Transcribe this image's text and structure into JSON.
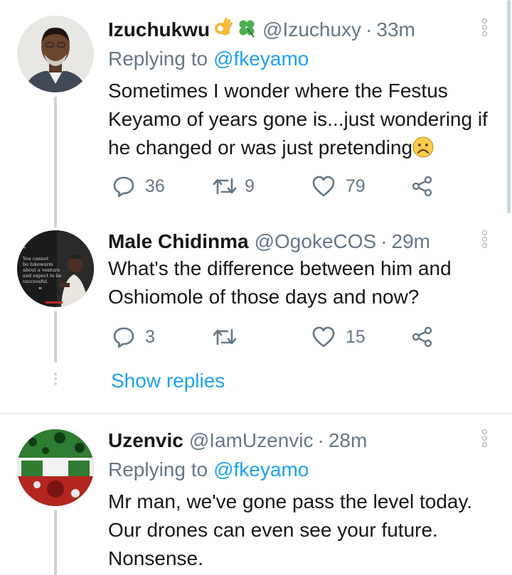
{
  "tweets": [
    {
      "name": "Izuchukwu",
      "emojis": [
        "ok-hand",
        "four-leaf-clover"
      ],
      "handle": "@Izuchuxy",
      "time": "33m",
      "replying_label": "Replying to",
      "replying_to": "@fkeyamo",
      "text": "Sometimes I wonder where the Festus Keyamo of years gone is...just wondering if he changed or was just pretending",
      "text_emoji": "frowning-face",
      "replies": "36",
      "retweets": "9",
      "likes": "79"
    },
    {
      "name": "Male Chidinma",
      "handle": "@OgokeCOS",
      "time": "29m",
      "text": "What's the difference between him and Oshiomole of those days and now?",
      "replies": "3",
      "retweets": "",
      "likes": "15",
      "show_replies": "Show replies"
    },
    {
      "name": "Uzenvic",
      "handle": "@IamUzenvic",
      "time": "28m",
      "replying_label": "Replying to",
      "replying_to": "@fkeyamo",
      "text": "Mr man, we've gone pass the level today. Our drones can even see your future. Nonsense."
    }
  ],
  "separator": "·",
  "avatar2_quote": "You cannot be lukewarm about a venture and expect to be successful.",
  "colors": {
    "link": "#1da1f2",
    "secondary": "#657786",
    "text": "#14171a",
    "thread": "#cbd3da"
  }
}
